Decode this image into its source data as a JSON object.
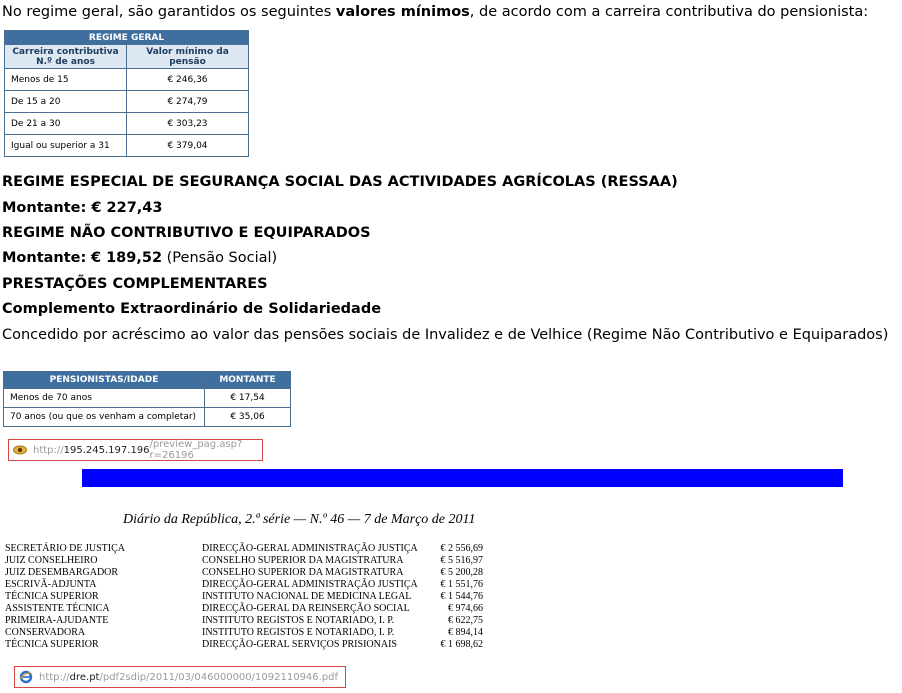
{
  "intro": {
    "before": "No regime geral, são garantidos os seguintes ",
    "bold": "valores mínimos",
    "after": ", de acordo com a carreira contributiva do pensionista:"
  },
  "table1": {
    "title": "REGIME GERAL",
    "col1": "Carreira contributiva N.º de anos",
    "col2": "Valor mínimo da pensão",
    "rows": [
      {
        "label": "Menos de 15",
        "value": "€ 246,36"
      },
      {
        "label": "De 15 a 20",
        "value": "€ 274,79"
      },
      {
        "label": "De 21 a 30",
        "value": "€ 303,23"
      },
      {
        "label": "Igual ou superior a 31",
        "value": "€ 379,04"
      }
    ]
  },
  "ressaa": {
    "heading": "REGIME ESPECIAL DE SEGURANÇA SOCIAL DAS ACTIVIDADES AGRÍCOLAS (RESSAA)",
    "label": "Montante:",
    "value": "€ 227,43"
  },
  "naocontrib": {
    "heading": "REGIME NÃO CONTRIBUTIVO E EQUIPARADOS",
    "label": "Montante:",
    "value": "€ 189,52",
    "note": "(Pensão Social)"
  },
  "prestacoes": {
    "heading": "PRESTAÇÕES COMPLEMENTARES",
    "subheading": "Complemento Extraordinário de Solidariedade",
    "text": "Concedido por acréscimo ao valor das pensões sociais de Invalidez e de Velhice (Regime Não Contributivo e Equiparados)"
  },
  "table2": {
    "col1": "PENSIONISTAS/IDADE",
    "col2": "MONTANTE",
    "rows": [
      {
        "label": "Menos de 70 anos",
        "value": "€ 17,54"
      },
      {
        "label": "70 anos (ou que os venham a completar)",
        "value": "€ 35,06"
      }
    ]
  },
  "url1": {
    "scheme": "http://",
    "host": "195.245.197.196",
    "path": "/preview_pag.asp?r=26196",
    "icon": "eye-icon"
  },
  "dre": {
    "title": "Diário da República, 2.ª série — N.º 46 — 7  de  Março  de  2011",
    "rows": [
      {
        "a": "SECRETÁRIO DE JUSTIÇA",
        "b": "DIRECÇÃO-GERAL ADMINISTRAÇÃO JUSTIÇA",
        "v": "€ 2 556,69"
      },
      {
        "a": "JUIZ CONSELHEIRO",
        "b": "CONSELHO SUPERIOR DA MAGISTRATURA",
        "v": "€ 5 516,97"
      },
      {
        "a": "JUIZ DESEMBARGADOR",
        "b": "CONSELHO SUPERIOR DA MAGISTRATURA",
        "v": "€ 5 200,28"
      },
      {
        "a": "ESCRIVÃ-ADJUNTA",
        "b": "DIRECÇÃO-GERAL ADMINISTRAÇÃO JUSTIÇA",
        "v": "€ 1 551,76"
      },
      {
        "a": "TÉCNICA SUPERIOR",
        "b": "INSTITUTO NACIONAL DE MEDICINA LEGAL",
        "v": "€ 1 544,76"
      },
      {
        "a": "ASSISTENTE TÉCNICA",
        "b": "DIRECÇÃO-GERAL DA REINSERÇÃO SOCIAL",
        "v": "€ 974,66"
      },
      {
        "a": "PRIMEIRA-AJUDANTE",
        "b": "INSTITUTO REGISTOS E NOTARIADO, I. P.",
        "v": "€ 622,75"
      },
      {
        "a": "CONSERVADORA",
        "b": "INSTITUTO REGISTOS E NOTARIADO, I. P.",
        "v": "€ 894,14"
      },
      {
        "a": "TÉCNICA SUPERIOR",
        "b": "DIRECÇÃO-GERAL SERVIÇOS PRISIONAIS",
        "v": "€ 1 698,62"
      }
    ]
  },
  "url2": {
    "scheme": "http://",
    "host": "dre.pt",
    "path": "/pdf2sdip/2011/03/046000000/1092110946.pdf",
    "icon": "ie-icon"
  }
}
